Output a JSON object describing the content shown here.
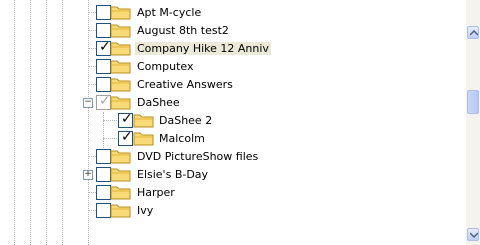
{
  "tree": {
    "items": [
      {
        "label": "Apt M-cycle",
        "checked": false,
        "selected": false
      },
      {
        "label": "August 8th test2",
        "checked": false,
        "selected": false
      },
      {
        "label": "Company Hike 12 Anniv",
        "checked": true,
        "selected": true
      },
      {
        "label": "Computex",
        "checked": false,
        "selected": false
      },
      {
        "label": "Creative Answers",
        "checked": false,
        "selected": false
      },
      {
        "label": "DaShee",
        "checked": "partial",
        "selected": false,
        "expander": "−"
      },
      {
        "label": "DaShee 2",
        "checked": true,
        "selected": false
      },
      {
        "label": "Malcolm",
        "checked": true,
        "selected": false
      },
      {
        "label": "DVD PictureShow files",
        "checked": false,
        "selected": false
      },
      {
        "label": "Elsie's B-Day",
        "checked": false,
        "selected": false,
        "expander": "+"
      },
      {
        "label": "Harper",
        "checked": false,
        "selected": false
      },
      {
        "label": "Ivy",
        "checked": false,
        "selected": false
      }
    ]
  },
  "icons": {
    "folder": "folder-icon",
    "checkmark": "✓",
    "scroll_up": "scroll-up-arrow-icon",
    "scroll_down": "scroll-down-arrow-icon"
  },
  "colors": {
    "folder_fill": "#f9d978",
    "folder_stroke": "#b8901c",
    "selected_bg": "#ece9d8",
    "tree_lines": "#b8b8b8"
  }
}
